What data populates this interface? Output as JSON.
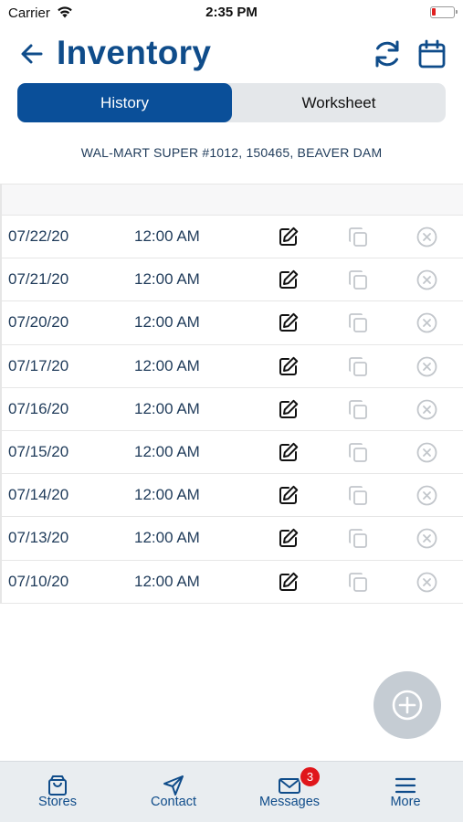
{
  "status_bar": {
    "carrier": "Carrier",
    "time": "2:35 PM",
    "battery_color": "#e02020"
  },
  "header": {
    "title": "Inventory",
    "back_icon": "arrow-left-icon",
    "refresh_icon": "refresh-icon",
    "calendar_icon": "calendar-icon"
  },
  "segments": {
    "history": "History",
    "worksheet": "Worksheet",
    "selected": "History"
  },
  "store": {
    "name": "WAL-MART SUPER #1012, 150465, BEAVER DAM"
  },
  "rows": [
    {
      "date": "07/22/20",
      "time": "12:00 AM"
    },
    {
      "date": "07/21/20",
      "time": "12:00 AM"
    },
    {
      "date": "07/20/20",
      "time": "12:00 AM"
    },
    {
      "date": "07/17/20",
      "time": "12:00 AM"
    },
    {
      "date": "07/16/20",
      "time": "12:00 AM"
    },
    {
      "date": "07/15/20",
      "time": "12:00 AM"
    },
    {
      "date": "07/14/20",
      "time": "12:00 AM"
    },
    {
      "date": "07/13/20",
      "time": "12:00 AM"
    },
    {
      "date": "07/10/20",
      "time": "12:00 AM"
    }
  ],
  "row_actions": {
    "edit_icon": "edit-icon",
    "copy_icon": "copy-icon",
    "delete_icon": "close-circle-icon"
  },
  "fab": {
    "icon": "plus-circle-icon"
  },
  "tabbar": {
    "stores": "Stores",
    "contact": "Contact",
    "messages": "Messages",
    "messages_badge": "3",
    "more": "More"
  },
  "colors": {
    "brand": "#0f4c8a",
    "segment_active": "#0a4f99",
    "badge": "#e0161b"
  }
}
